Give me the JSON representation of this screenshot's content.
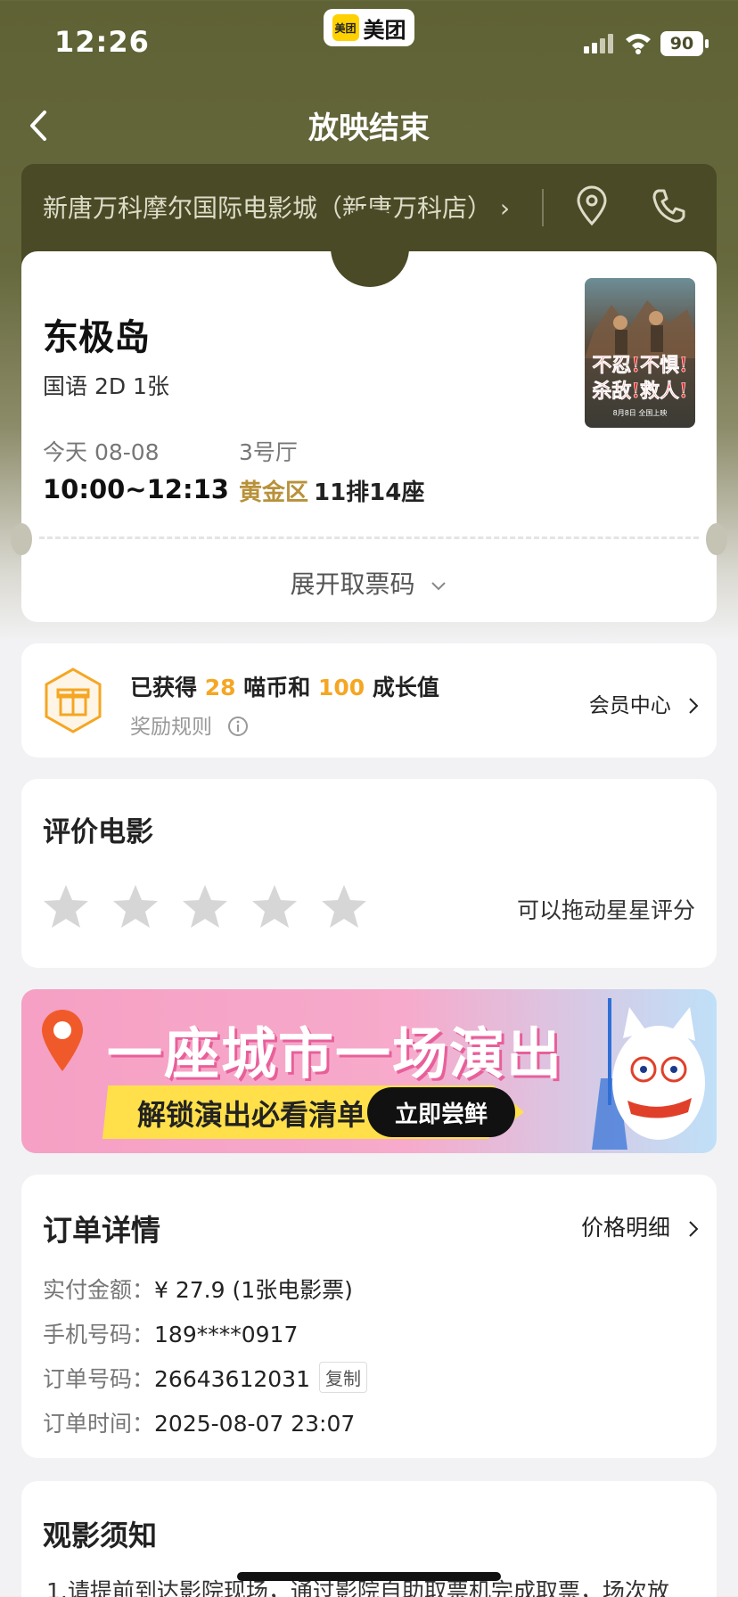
{
  "status_bar": {
    "time": "12:26",
    "app_badge_logo": "美团",
    "app_badge_name": "美团",
    "battery": "90"
  },
  "nav": {
    "title": "放映结束"
  },
  "cinema": {
    "name": "新唐万科摩尔国际电影城（新唐万科店）",
    "chevron": "›"
  },
  "ticket": {
    "movie_title": "东极岛",
    "format": "国语 2D 1张",
    "date": "今天 08-08",
    "time_range": "10:00~12:13",
    "hall": "3号厅",
    "seat_zone": "黄金区",
    "seat": "11排14座",
    "poster_text_line1": "不忍!不惧!",
    "poster_text_line2": "杀敌!救人!",
    "poster_caption": "8月8日 全国上映",
    "expand_label": "展开取票码"
  },
  "reward": {
    "prefix": "已获得",
    "coins": "28",
    "middle": "喵币和",
    "growth": "100",
    "suffix": "成长值",
    "rule_label": "奖励规则",
    "member_link": "会员中心"
  },
  "rating": {
    "title": "评价电影",
    "hint": "可以拖动星星评分",
    "stars": 5,
    "current_rating": 0
  },
  "banner": {
    "title": "一座城市一场演出",
    "subtitle": "解锁演出必看清单",
    "cta": "立即尝鲜"
  },
  "order": {
    "title": "订单详情",
    "price_detail_link": "价格明细",
    "rows": [
      {
        "label": "实付金额：",
        "value": "¥ 27.9 (1张电影票)"
      },
      {
        "label": "手机号码：",
        "value": "189****0917"
      },
      {
        "label": "订单号码：",
        "value": "26643612031",
        "copy": "复制"
      },
      {
        "label": "订单时间：",
        "value": "2025-08-07 23:07"
      }
    ]
  },
  "notice": {
    "title": "观影须知",
    "text": "1.请提前到达影院现场，通过影院自助取票机完成取票，场次放"
  },
  "colors": {
    "accent_gold": "#b8913a",
    "highlight_orange": "#f5a623",
    "header_olive": "#4a4a26"
  },
  "icons": [
    "back-icon",
    "location-icon",
    "phone-icon",
    "chevron-down-icon",
    "gift-icon",
    "info-icon",
    "chevron-right-icon",
    "star-icon",
    "signal-icon",
    "wifi-icon",
    "battery-icon"
  ]
}
